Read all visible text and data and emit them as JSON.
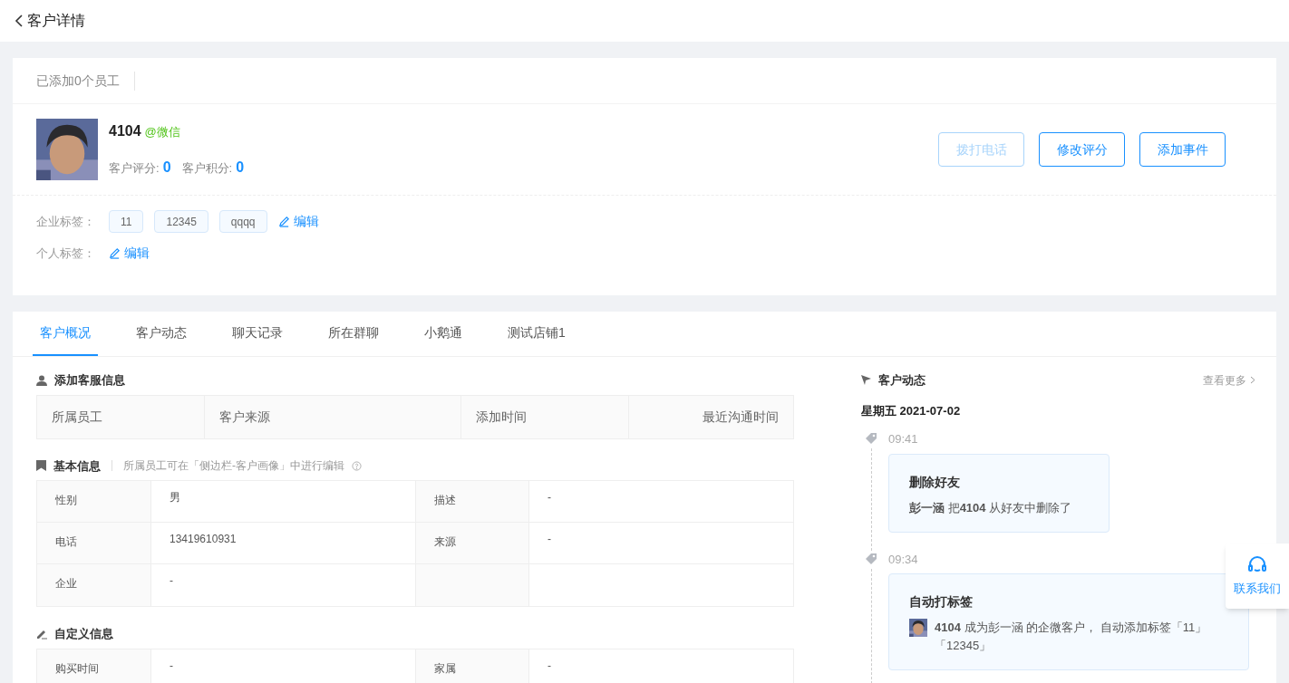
{
  "header": {
    "title": "客户详情"
  },
  "staff_bar": {
    "text": "已添加0个员工"
  },
  "customer": {
    "name": "4104",
    "source": "@微信",
    "score_label": "客户评分:",
    "score": "0",
    "points_label": "客户积分:",
    "points": "0"
  },
  "actions": [
    {
      "label": "拨打电话",
      "disabled": true
    },
    {
      "label": "修改评分",
      "disabled": false
    },
    {
      "label": "添加事件",
      "disabled": false
    }
  ],
  "tag_rows": [
    {
      "label": "企业标签：",
      "tags": [
        "11",
        "12345",
        "qqqq"
      ],
      "edit": "编辑"
    },
    {
      "label": "个人标签：",
      "edit": "编辑"
    }
  ],
  "tabs": [
    {
      "label": "客户概况",
      "selected": true
    },
    {
      "label": "客户动态",
      "selected": false
    },
    {
      "label": "聊天记录",
      "selected": false
    },
    {
      "label": "所在群聊",
      "selected": false
    },
    {
      "label": "小鹅通",
      "selected": false
    },
    {
      "label": "测试店铺1",
      "selected": false
    }
  ],
  "service_info": {
    "title": "添加客服信息",
    "columns": [
      "所属员工",
      "客户来源",
      "添加时间",
      "最近沟通时间"
    ]
  },
  "basic_info": {
    "title": "基本信息",
    "hint": "所属员工可在「侧边栏-客户画像」中进行编辑",
    "rows": [
      [
        "性别",
        "男",
        "描述",
        "-"
      ],
      [
        "电话",
        "13419610931",
        "来源",
        "-"
      ],
      [
        "企业",
        "-"
      ]
    ]
  },
  "custom_info": {
    "title": "自定义信息",
    "rows": [
      [
        "购买时间",
        "-",
        "家属",
        "-"
      ]
    ]
  },
  "activity": {
    "title": "客户动态",
    "more": "查看更多",
    "date": "星期五 2021-07-02",
    "events": [
      {
        "kind": "plain",
        "time": "09:41",
        "title": "删除好友",
        "text": "**彭一涵** 把**4104** 从好友中删除了"
      },
      {
        "kind": "avatar",
        "time": "09:34",
        "title": "自动打标签",
        "text": "**4104** 成为彭一涵 的企微客户， 自动添加标签「11」「12345」"
      }
    ]
  },
  "contact": {
    "label": "联系我们"
  }
}
